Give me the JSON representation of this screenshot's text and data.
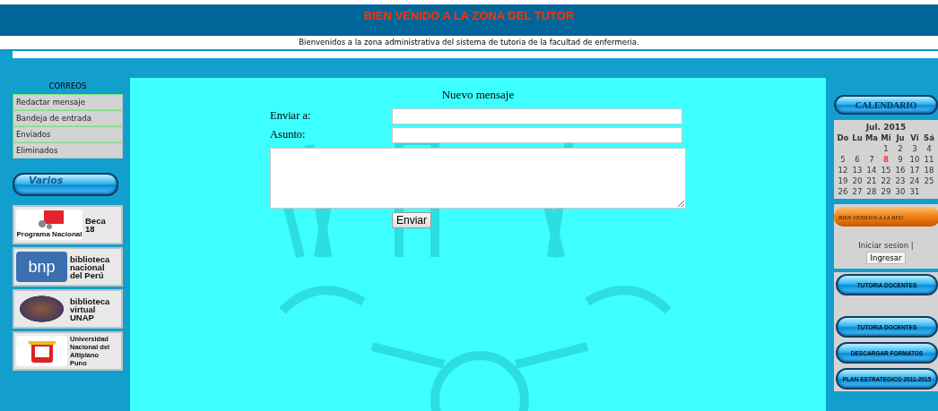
{
  "header": {
    "title": "BIEN VENIDO A LA ZONA DEL TUTOR",
    "subtitle": "Bienvenidos a la zona administrativa del sistema de tutoria de la facultad de enfermeria."
  },
  "mail_menu": {
    "title": "CORREOS",
    "items": [
      {
        "label": "Redactar mensaje"
      },
      {
        "label": "Bandeja de entrada"
      },
      {
        "label": "Enviados"
      },
      {
        "label": "Eliminados"
      }
    ]
  },
  "varios": {
    "title": "Varios",
    "banners": [
      {
        "kind": "beca",
        "lines": [
          "Beca",
          "18"
        ],
        "caption": "Programa Nacional"
      },
      {
        "kind": "bnp",
        "lines": [
          "biblioteca",
          "nacional",
          "del Perú"
        ],
        "caption": "bnp"
      },
      {
        "kind": "unap",
        "lines": [
          "biblioteca",
          "virtual",
          "UNAP"
        ]
      },
      {
        "kind": "altiplano",
        "lines": [
          "Universidad",
          "Nacional del",
          "Altiplano",
          "Puno"
        ]
      }
    ]
  },
  "compose": {
    "title": "Nuevo mensaje",
    "to_label": "Enviar a:",
    "subject_label": "Asunto:",
    "send_button": "Enviar"
  },
  "calendar": {
    "title": "CALENDARIO",
    "month": "Jul. 2015",
    "weekdays": [
      "Do",
      "Lu",
      "Ma",
      "Mi",
      "Ju",
      "Vi",
      "Sá"
    ],
    "weeks": [
      [
        {
          "day": "1",
          "today": false
        },
        {
          "day": "2",
          "today": false
        },
        {
          "day": "3",
          "today": false
        },
        {
          "day": "4",
          "today": false
        }
      ],
      [
        {
          "day": "5",
          "today": false
        },
        {
          "day": "6",
          "today": false
        },
        {
          "day": "7",
          "today": false
        },
        {
          "day": "8",
          "today": true
        },
        {
          "day": "9",
          "today": false
        },
        {
          "day": "10",
          "today": false
        },
        {
          "day": "11",
          "today": false
        }
      ],
      [
        {
          "day": "12",
          "today": false
        },
        {
          "day": "13",
          "today": false
        },
        {
          "day": "14",
          "today": false
        },
        {
          "day": "15",
          "today": false
        },
        {
          "day": "16",
          "today": false
        },
        {
          "day": "17",
          "today": false
        },
        {
          "day": "18",
          "today": false
        }
      ],
      [
        {
          "day": "19",
          "today": false
        },
        {
          "day": "20",
          "today": false
        },
        {
          "day": "21",
          "today": false
        },
        {
          "day": "22",
          "today": false
        },
        {
          "day": "23",
          "today": false
        },
        {
          "day": "24",
          "today": false
        },
        {
          "day": "25",
          "today": false
        }
      ],
      [
        {
          "day": "26",
          "today": false
        },
        {
          "day": "27",
          "today": false
        },
        {
          "day": "28",
          "today": false
        },
        {
          "day": "29",
          "today": false
        },
        {
          "day": "30",
          "today": false
        },
        {
          "day": "31",
          "today": false
        }
      ]
    ]
  },
  "network": {
    "title": "BIEN VENIDOS A LA RED",
    "login_text": "Iniciar sesion |",
    "login_button": "Ingresar"
  },
  "links": [
    {
      "label": "TUTORIA DOCENTES"
    },
    {
      "label": "TUTORIA DOCENTES"
    },
    {
      "label": "DESCARGAR FORMATOS"
    },
    {
      "label": "PLAN ESTRATEGICO 2011-2015"
    }
  ]
}
